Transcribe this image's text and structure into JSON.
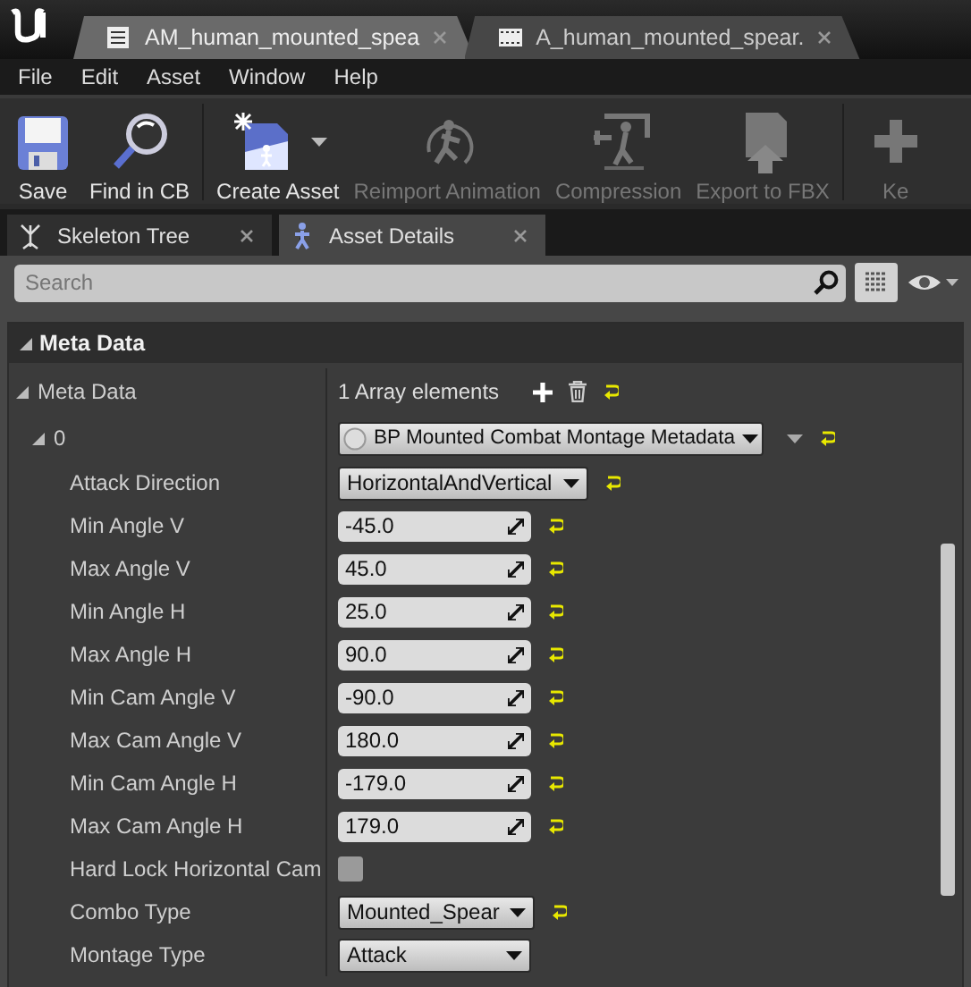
{
  "document_tabs": [
    {
      "title": "AM_human_mounted_spea",
      "kind": "montage",
      "selected": true
    },
    {
      "title": "A_human_mounted_spear.",
      "kind": "sequence",
      "selected": false
    }
  ],
  "menu": [
    "File",
    "Edit",
    "Asset",
    "Window",
    "Help"
  ],
  "toolbar": [
    {
      "label": "Save",
      "kind": "save",
      "disabled": false
    },
    {
      "label": "Find in CB",
      "kind": "find",
      "disabled": false
    },
    {
      "label": "Create Asset",
      "kind": "create",
      "disabled": false,
      "dropdown": true
    },
    {
      "label": "Reimport Animation",
      "kind": "reimport",
      "disabled": true
    },
    {
      "label": "Compression",
      "kind": "compression",
      "disabled": true
    },
    {
      "label": "Export to FBX",
      "kind": "export",
      "disabled": true
    },
    {
      "label": "Ke",
      "kind": "plus",
      "disabled": true
    }
  ],
  "panel_tabs": [
    {
      "label": "Skeleton Tree",
      "kind": "tree",
      "selected": false
    },
    {
      "label": "Asset Details",
      "kind": "figure",
      "selected": true
    }
  ],
  "search": {
    "placeholder": "Search"
  },
  "section": {
    "title": "Meta Data",
    "expanded": true,
    "rows": [
      {
        "label": "Meta Data",
        "kind": "array",
        "value": "1 Array elements",
        "expanded": true,
        "modified": true,
        "children": [
          {
            "label": "0",
            "kind": "object",
            "value": "BP Mounted Combat Montage Metadata",
            "expanded": true,
            "modified": true,
            "children": [
              {
                "label": "Attack Direction",
                "kind": "enum",
                "value": "HorizontalAndVertical",
                "modified": true
              },
              {
                "label": "Min Angle V",
                "kind": "number",
                "value": "-45.0",
                "modified": true
              },
              {
                "label": "Max Angle V",
                "kind": "number",
                "value": "45.0",
                "modified": true
              },
              {
                "label": "Min Angle H",
                "kind": "number",
                "value": "25.0",
                "modified": true
              },
              {
                "label": "Max Angle H",
                "kind": "number",
                "value": "90.0",
                "modified": true
              },
              {
                "label": "Min Cam Angle V",
                "kind": "number",
                "value": "-90.0",
                "modified": true
              },
              {
                "label": "Max Cam Angle V",
                "kind": "number",
                "value": "180.0",
                "modified": true
              },
              {
                "label": "Min Cam Angle H",
                "kind": "number",
                "value": "-179.0",
                "modified": true
              },
              {
                "label": "Max Cam Angle H",
                "kind": "number",
                "value": "179.0",
                "modified": true
              },
              {
                "label": "Hard Lock Horizontal Cam",
                "kind": "checkbox",
                "checked": false,
                "modified": false
              },
              {
                "label": "Combo Type",
                "kind": "enum",
                "value": "Mounted_Spear",
                "modified": true
              },
              {
                "label": "Montage Type",
                "kind": "enum",
                "value": "Attack",
                "modified": false
              }
            ]
          }
        ]
      }
    ]
  }
}
